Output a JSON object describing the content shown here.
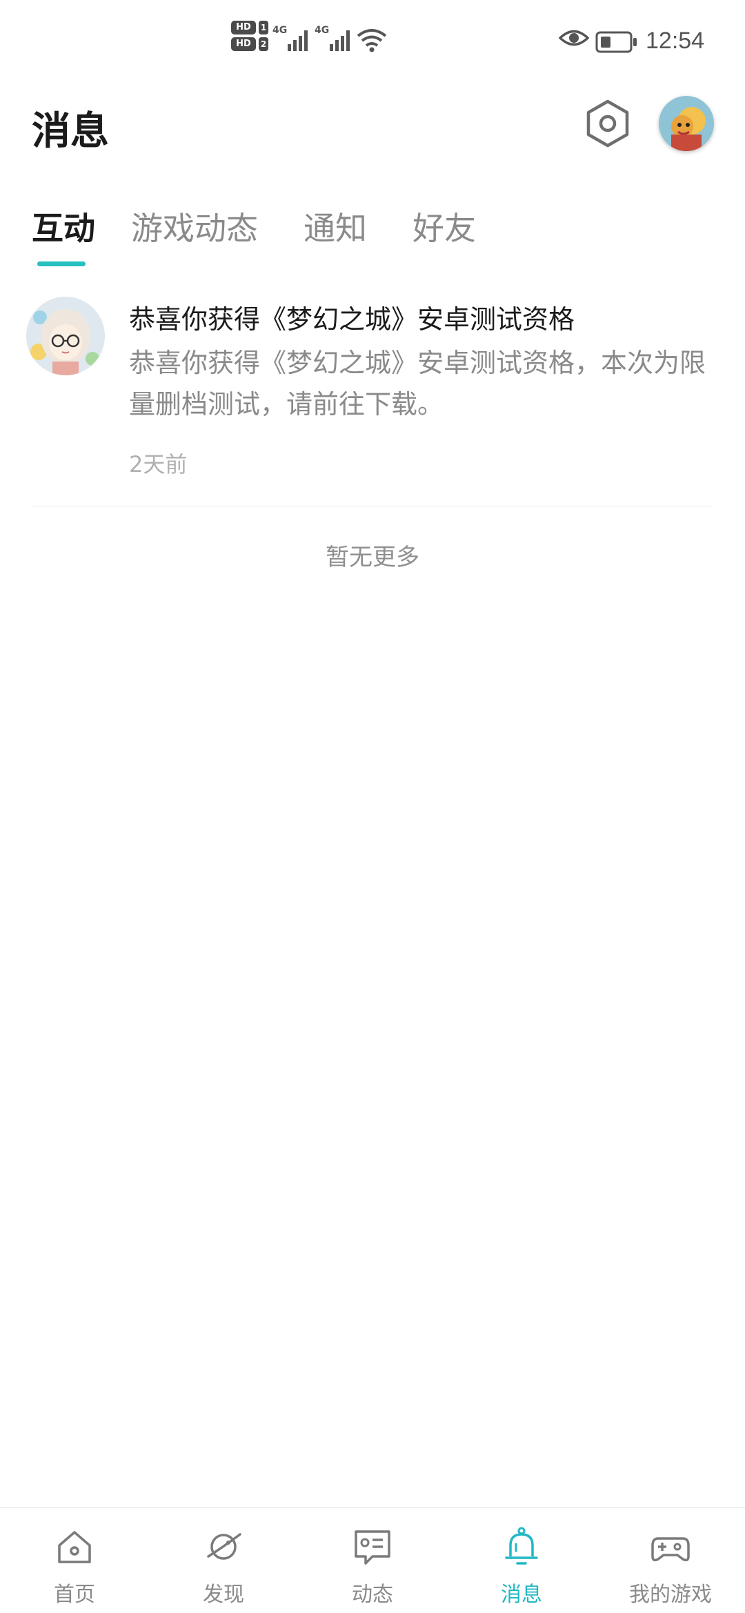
{
  "status_bar": {
    "sim1_label": "HD",
    "sim1_num": "1",
    "sim2_label": "HD",
    "sim2_num": "2",
    "network1": "4G",
    "network2": "4G",
    "time": "12:54"
  },
  "header": {
    "title": "消息",
    "settings_icon": "hexagon-settings-icon",
    "avatar_icon": "user-avatar"
  },
  "tabs": [
    {
      "label": "互动",
      "active": true
    },
    {
      "label": "游戏动态",
      "active": false
    },
    {
      "label": "通知",
      "active": false
    },
    {
      "label": "好友",
      "active": false
    }
  ],
  "messages": [
    {
      "title": "恭喜你获得《梦幻之城》安卓测试资格",
      "body": "恭喜你获得《梦幻之城》安卓测试资格，本次为限量删档测试，请前往下载。",
      "time": "2天前"
    }
  ],
  "list_end_text": "暂无更多",
  "bottom_nav": [
    {
      "label": "首页",
      "icon": "home-icon",
      "active": false
    },
    {
      "label": "发现",
      "icon": "planet-icon",
      "active": false
    },
    {
      "label": "动态",
      "icon": "feed-card-icon",
      "active": false
    },
    {
      "label": "消息",
      "icon": "bell-icon",
      "active": true
    },
    {
      "label": "我的游戏",
      "icon": "gamepad-icon",
      "active": false
    }
  ],
  "colors": {
    "accent": "#27c0c0",
    "nav_active": "#20b8c4",
    "text_primary": "#1b1b1b",
    "text_secondary": "#8a8a8a"
  }
}
